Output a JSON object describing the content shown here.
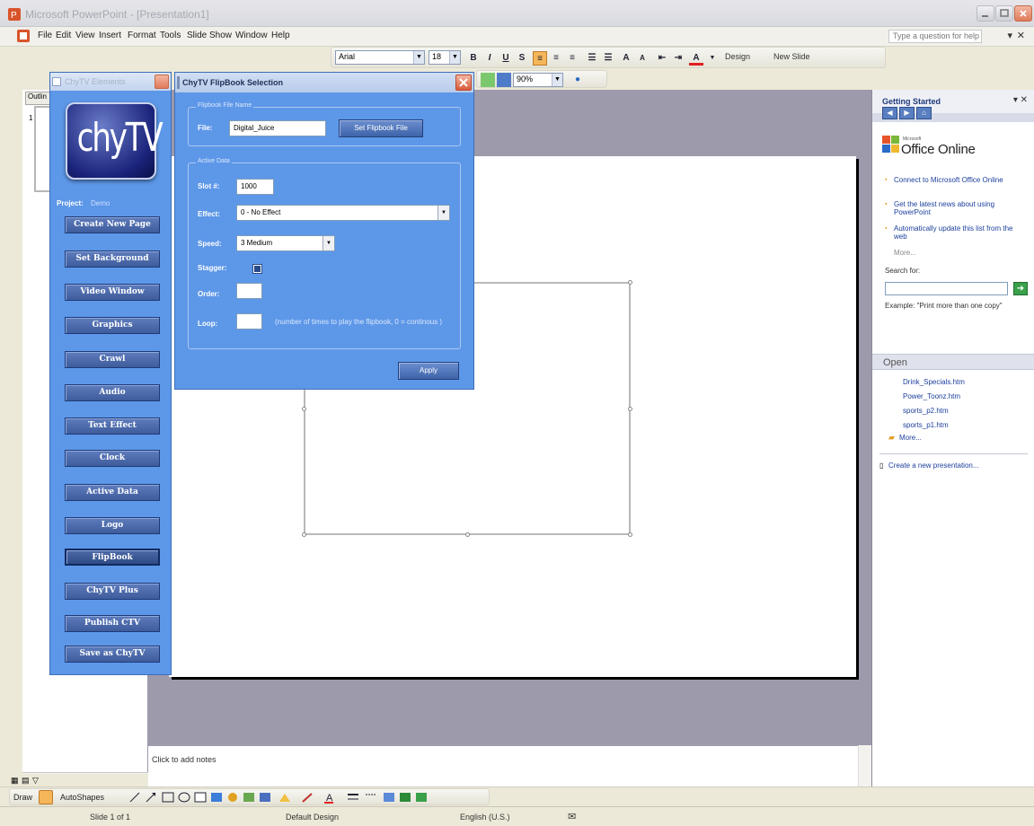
{
  "window": {
    "title": "Microsoft PowerPoint - [Presentation1]"
  },
  "menubar": {
    "items": [
      "File",
      "Edit",
      "View",
      "Insert",
      "Format",
      "Tools",
      "Slide Show",
      "Window",
      "Help"
    ],
    "help_placeholder": "Type a question for help"
  },
  "format_toolbar": {
    "font": "Arial",
    "size": "18",
    "bold": "B",
    "italic": "I",
    "underline": "U",
    "shadow": "S",
    "design_label": "Design",
    "new_slide_label": "New Slide"
  },
  "std_toolbar": {
    "zoom": "90%"
  },
  "outline": {
    "tab_label": "Outlin",
    "slide_number": "1"
  },
  "notes": {
    "placeholder": "Click to add notes"
  },
  "task_pane": {
    "title": "Getting Started",
    "office_online_label": "Office Online",
    "microsoft_small": "Microsoft",
    "links": [
      "Connect to Microsoft Office Online",
      "Get the latest news about using PowerPoint",
      "Automatically update this list from the web"
    ],
    "more_label": "More...",
    "search_label": "Search for:",
    "example_text": "Example:  \"Print more than one copy\"",
    "open_heading": "Open",
    "open_files": [
      "Drink_Specials.htm",
      "Power_Toonz.htm",
      "sports_p2.htm",
      "sports_p1.htm"
    ],
    "open_more": "More...",
    "new_presentation": "Create a new presentation..."
  },
  "draw_toolbar": {
    "draw_label": "Draw",
    "autoshapes_label": "AutoShapes"
  },
  "statusbar": {
    "slide": "Slide 1 of 1",
    "design": "Default Design",
    "language": "English (U.S.)"
  },
  "chy_elements": {
    "title": "ChyTV Elements",
    "logo_text": "chyTV",
    "project_label": "Project:",
    "project_value": "Demo",
    "buttons": [
      "Create New Page",
      "Set Background",
      "Video Window",
      "Graphics",
      "Crawl",
      "Audio",
      "Text Effect",
      "Clock",
      "Active Data",
      "Logo",
      "FlipBook",
      "ChyTV Plus",
      "Publish CTV",
      "Save as ChyTV"
    ],
    "active_button": "FlipBook"
  },
  "flipbook": {
    "title": "ChyTV FlipBook Selection",
    "file_group_label": "Flipbook File Name",
    "file_label": "File:",
    "file_value": "Digital_Juice",
    "set_file_button": "Set Flipbook File",
    "active_group_label": "Active Data",
    "slot_label": "Slot #:",
    "slot_value": "1000",
    "effect_label": "Effect:",
    "effect_value": "0 - No Effect",
    "speed_label": "Speed:",
    "speed_value": "3 Medium",
    "stagger_label": "Stagger:",
    "stagger_checked": true,
    "order_label": "Order:",
    "order_value": "",
    "loop_label": "Loop:",
    "loop_value": "",
    "loop_note": "(number of times to play the flipbook, 0 = continous )",
    "apply_button": "Apply"
  },
  "colors": {
    "panel_blue": "#5d97e8",
    "button_blue": "#3e5c9c",
    "slide_area": "#9d9aac"
  }
}
